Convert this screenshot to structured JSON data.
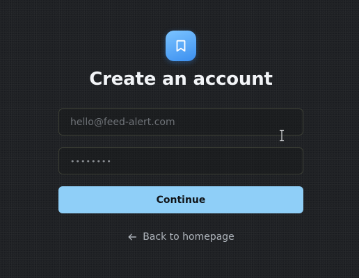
{
  "icons": {
    "logo": "bookmark-icon",
    "back": "arrow-left-icon",
    "cursor": "text-cursor-icon"
  },
  "colors": {
    "logo_gradient_start": "#7cc4ff",
    "logo_gradient_end": "#3b8ff0",
    "primary_button": "#8fcff8",
    "background": "#1f2124"
  },
  "page": {
    "title": "Create an account"
  },
  "form": {
    "email_placeholder": "hello@feed-alert.com",
    "password_placeholder": "••••••••",
    "submit_label": "Continue"
  },
  "links": {
    "back_label": "Back to homepage"
  }
}
